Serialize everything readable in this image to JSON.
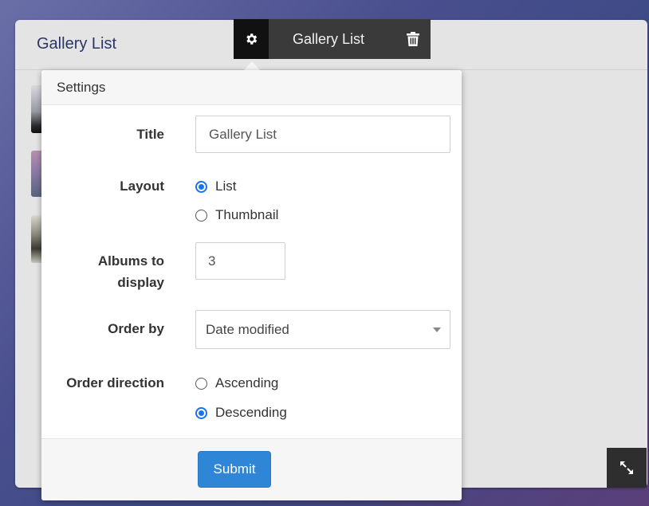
{
  "widget": {
    "title": "Gallery List"
  },
  "toolbar": {
    "title": "Gallery List",
    "settings_icon": "gear-icon",
    "delete_icon": "trash-icon"
  },
  "settings": {
    "heading": "Settings",
    "title_label": "Title",
    "title_value": "Gallery List",
    "layout_label": "Layout",
    "layout_options": [
      {
        "label": "List",
        "selected": true
      },
      {
        "label": "Thumbnail",
        "selected": false
      }
    ],
    "albums_label_line1": "Albums to",
    "albums_label_line2": "display",
    "albums_value": "3",
    "order_by_label": "Order by",
    "order_by_value": "Date modified",
    "order_direction_label": "Order direction",
    "order_direction_options": [
      {
        "label": "Ascending",
        "selected": false
      },
      {
        "label": "Descending",
        "selected": true
      }
    ],
    "submit_label": "Submit"
  },
  "colors": {
    "accent": "#1a73e8",
    "submit": "#2f86d6",
    "title_text": "#2b3568"
  },
  "fullscreen_icon": "expand-icon"
}
